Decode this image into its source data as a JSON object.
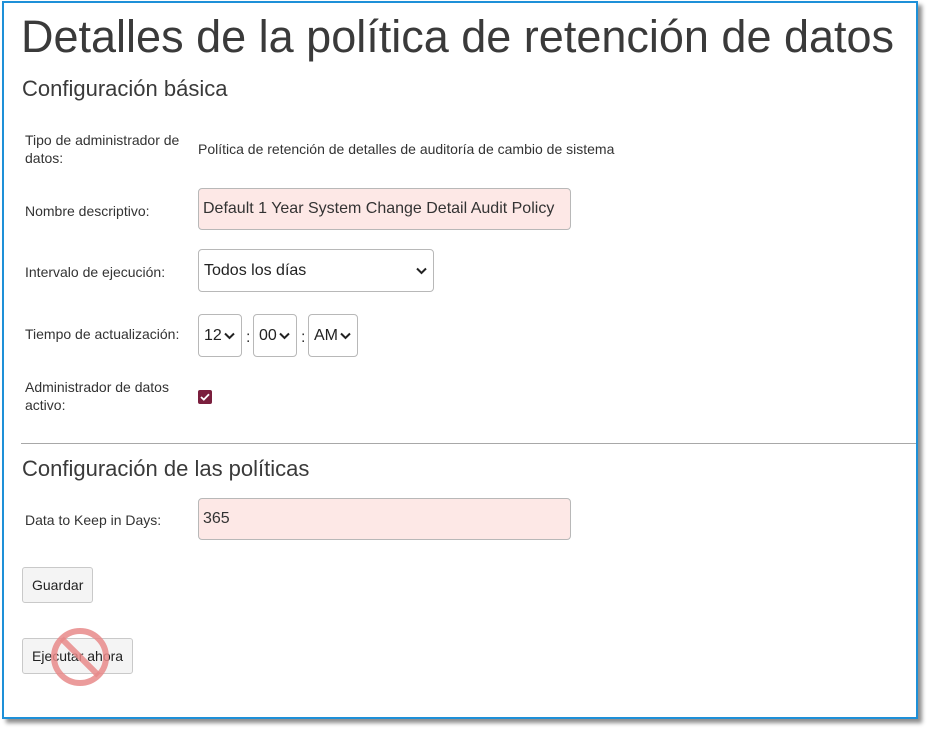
{
  "page": {
    "title": "Detalles de la política de retención de datos"
  },
  "basic_config": {
    "heading": "Configuración básica",
    "admin_type": {
      "label": "Tipo de administrador de datos:",
      "value": "Política de retención de detalles de auditoría de cambio de sistema"
    },
    "descriptive_name": {
      "label": "Nombre descriptivo:",
      "value": "Default 1 Year System Change Detail Audit Policy"
    },
    "run_interval": {
      "label": "Intervalo de ejecución:",
      "value": "Todos los días"
    },
    "update_time": {
      "label": "Tiempo de actualización:",
      "hour": "12",
      "minute": "00",
      "ampm": "AM",
      "separator": ":"
    },
    "active": {
      "label": "Administrador de datos activo:",
      "checked": true
    }
  },
  "policy_config": {
    "heading": "Configuración de las políticas",
    "keep_days": {
      "label": "Data to Keep in Days:",
      "value": "365"
    }
  },
  "buttons": {
    "save_label": "Guardar",
    "run_now_label": "Ejecutar ahora"
  },
  "icons": {
    "run_now_overlay": "prohibited-icon",
    "select_arrow": "chevron-down-icon",
    "checkbox_mark": "checkmark-icon"
  },
  "colors": {
    "frame_border": "#1e90d8",
    "input_invalid_bg": "#fde8e6",
    "checkbox_accent": "#7a1f3d",
    "prohibited_overlay": "#e88a8a"
  }
}
